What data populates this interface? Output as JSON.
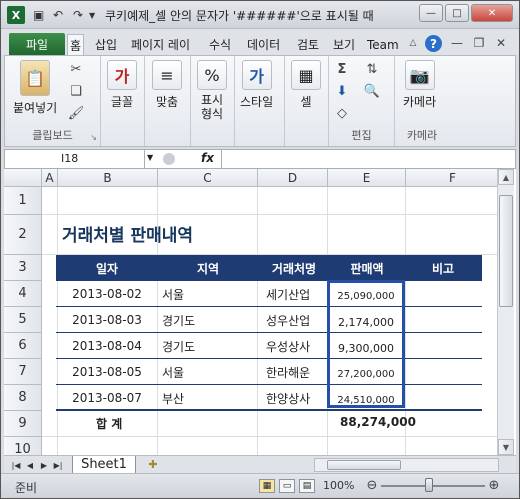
{
  "window": {
    "title": "쿠키예제_셀 안의 문자가 '######'으로 표시될 때",
    "controls": {
      "minimize": "—",
      "maximize": "□",
      "close": "✕"
    }
  },
  "quick_access": {
    "icon_names": [
      "excel-logo",
      "save-icon",
      "undo-icon",
      "redo-icon",
      "customize-icon"
    ]
  },
  "ribbon_tabs": {
    "file": "파일",
    "tabs": [
      "홈",
      "삽입",
      "페이지 레이",
      "수식",
      "데이터",
      "검토",
      "보기",
      "Team"
    ],
    "active": "홈"
  },
  "ribbon_groups": {
    "clipboard": {
      "label": "클립보드",
      "paste": "붙여넣기"
    },
    "font": {
      "label": "글꼴"
    },
    "alignment": {
      "label": "맞춤"
    },
    "number": {
      "label": "표시\n형식"
    },
    "styles": {
      "label": "스타일"
    },
    "cells": {
      "label": "셀"
    },
    "editing": {
      "label": "편집"
    },
    "camera": {
      "label": "카메라",
      "group_label": "카메라"
    }
  },
  "formula_bar": {
    "name_box": "I18",
    "fx": "fx",
    "formula": ""
  },
  "columns": [
    "A",
    "B",
    "C",
    "D",
    "E",
    "F"
  ],
  "rows": [
    "1",
    "2",
    "3",
    "4",
    "5",
    "6",
    "7",
    "8",
    "9",
    "10"
  ],
  "sheet": {
    "title": "거래처별 판매내역",
    "headers": [
      "일자",
      "지역",
      "거래처명",
      "판매액",
      "비고"
    ],
    "records": [
      {
        "date": "2013-08-02",
        "region": "서울",
        "client": "세기산업",
        "amount": "25,090,000"
      },
      {
        "date": "2013-08-03",
        "region": "경기도",
        "client": "성우산업",
        "amount": "2,174,000"
      },
      {
        "date": "2013-08-04",
        "region": "경기도",
        "client": "우성상사",
        "amount": "9,300,000"
      },
      {
        "date": "2013-08-05",
        "region": "서울",
        "client": "한라해운",
        "amount": "27,200,000"
      },
      {
        "date": "2013-08-07",
        "region": "부산",
        "client": "한양상사",
        "amount": "24,510,000"
      }
    ],
    "total_label": "합 계",
    "total_value": "88,274,000"
  },
  "sheet_tabs": {
    "active": "Sheet1"
  },
  "status_bar": {
    "status": "준비",
    "zoom": "100%"
  },
  "colors": {
    "header_fill": "#1f3b73",
    "title_text": "#17365d",
    "highlight_border": "#2650a8",
    "file_tab": "#21672f"
  }
}
